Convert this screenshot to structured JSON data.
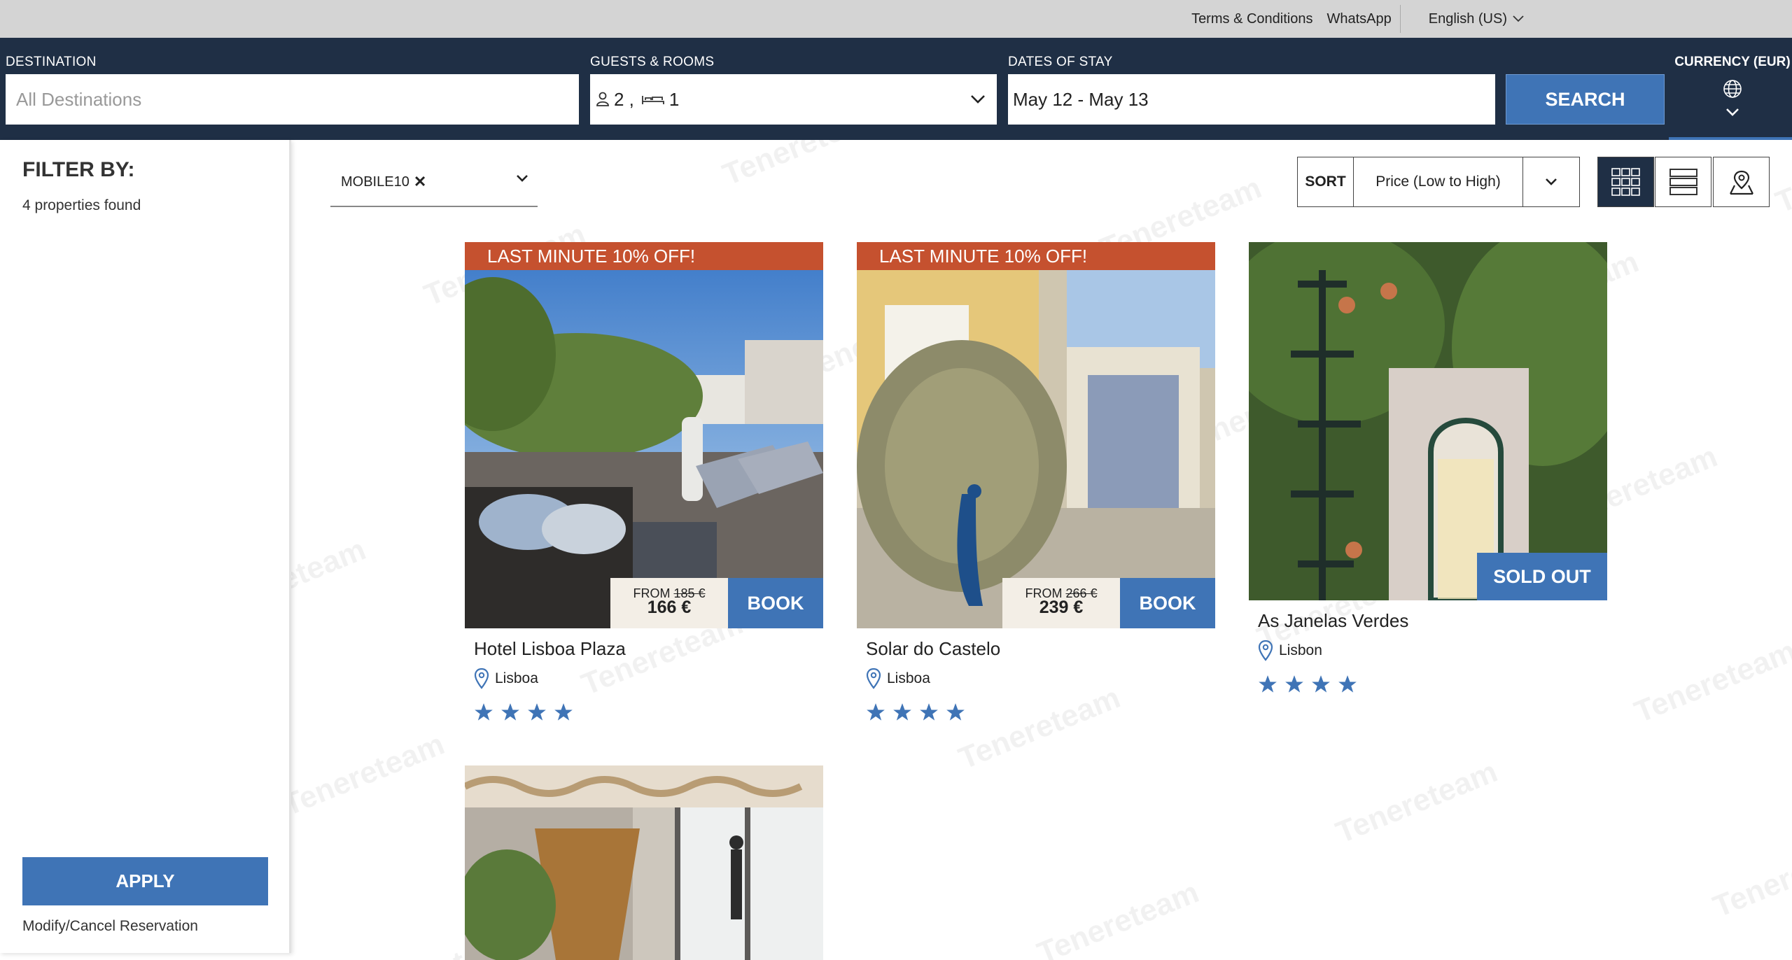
{
  "topbar": {
    "terms_label": "Terms & Conditions",
    "whatsapp_label": "WhatsApp",
    "language_label": "English (US)"
  },
  "search": {
    "destination_label": "DESTINATION",
    "destination_placeholder": "All Destinations",
    "guests_label": "GUESTS & ROOMS",
    "guests_count": "2 ,",
    "rooms_count": "1",
    "dates_label": "DATES OF STAY",
    "dates_value": "May 12 - May 13",
    "search_button": "SEARCH",
    "currency_label": "CURRENCY (EUR)"
  },
  "sidebar": {
    "filter_title": "FILTER BY:",
    "found_text": "4 properties found",
    "apply_button": "APPLY",
    "modify_link": "Modify/Cancel Reservation"
  },
  "toolbar": {
    "promo_code": "MOBILE10",
    "sort_label": "SORT",
    "sort_value": "Price (Low to High)"
  },
  "cards": [
    {
      "ribbon": "LAST MINUTE 10% OFF!",
      "from_label": "FROM",
      "old_price": "185 €",
      "new_price": "166 €",
      "book_label": "BOOK",
      "name": "Hotel Lisboa Plaza",
      "location": "Lisboa",
      "stars": 4
    },
    {
      "ribbon": "LAST MINUTE 10% OFF!",
      "from_label": "FROM",
      "old_price": "266 €",
      "new_price": "239 €",
      "book_label": "BOOK",
      "name": "Solar do Castelo",
      "location": "Lisboa",
      "stars": 4
    },
    {
      "status": "SOLD OUT",
      "name": "As Janelas Verdes",
      "location": "Lisbon",
      "stars": 4
    }
  ],
  "colors": {
    "navy": "#1f2f45",
    "accent_blue": "#3f74b6",
    "ribbon_orange": "#c5512f",
    "price_bg": "#f3eee6"
  }
}
